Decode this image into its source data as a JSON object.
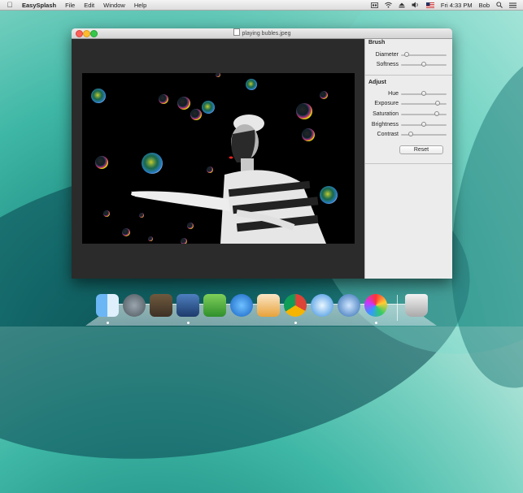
{
  "menubar": {
    "app_name": "EasySplash",
    "menus": [
      "File",
      "Edit",
      "Window",
      "Help"
    ],
    "clock": "Fri 4:33 PM",
    "user": "Bob"
  },
  "window": {
    "title": "playing bubles.jpeg"
  },
  "sidebar": {
    "brush": {
      "title": "Brush",
      "diameter_label": "Diameter",
      "diameter_value": 0.12,
      "softness_label": "Softness",
      "softness_value": 0.5
    },
    "adjust": {
      "title": "Adjust",
      "hue_label": "Hue",
      "hue_value": 0.5,
      "exposure_label": "Exposure",
      "exposure_value": 0.8,
      "saturation_label": "Saturation",
      "saturation_value": 0.78,
      "brightness_label": "Brightness",
      "brightness_value": 0.5,
      "contrast_label": "Contrast",
      "contrast_value": 0.22
    },
    "reset_label": "Reset"
  },
  "dock": {
    "items": [
      "finder-icon",
      "launchpad-icon",
      "photo-browser-icon",
      "xcode-icon",
      "evernote-icon",
      "app-store-icon",
      "pages-icon",
      "chrome-icon",
      "safari-icon",
      "mail-icon",
      "easysplash-icon",
      "trash-icon"
    ]
  },
  "colors": {
    "accent_close": "#fc5f57",
    "accent_min": "#fdbc2e",
    "accent_zoom": "#34c84a"
  }
}
